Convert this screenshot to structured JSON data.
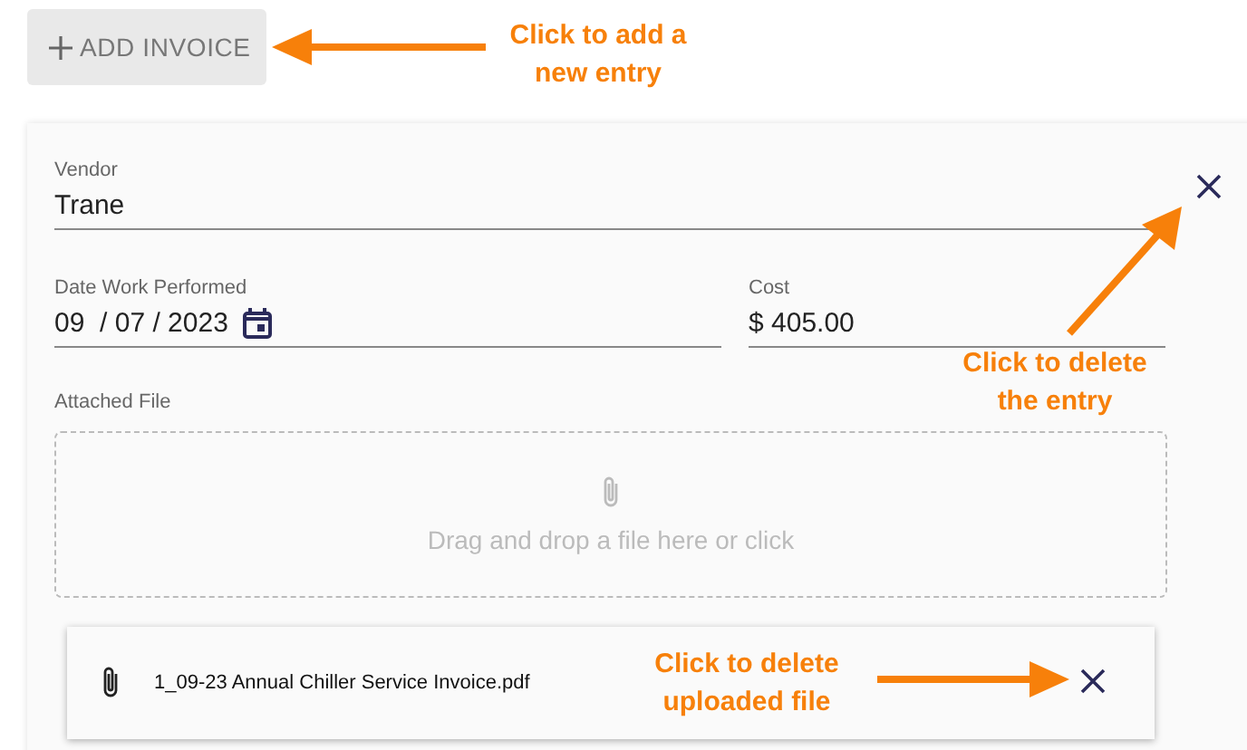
{
  "add_button": {
    "label": "ADD INVOICE"
  },
  "invoice": {
    "vendor": {
      "label": "Vendor",
      "value": "Trane"
    },
    "date": {
      "label": "Date Work Performed",
      "value": "09  / 07 / 2023"
    },
    "cost": {
      "label": "Cost",
      "value": "$ 405.00"
    },
    "attachment": {
      "label": "Attached File",
      "dropzone_text": "Drag and drop a file here or click"
    },
    "files": [
      {
        "name": "1_09-23 Annual Chiller Service Invoice.pdf"
      }
    ]
  },
  "annotations": [
    {
      "lines": [
        "Click to add a",
        "new entry"
      ]
    },
    {
      "lines": [
        "Click to delete",
        "the entry"
      ]
    },
    {
      "lines": [
        "Click to delete",
        "uploaded file"
      ]
    }
  ]
}
